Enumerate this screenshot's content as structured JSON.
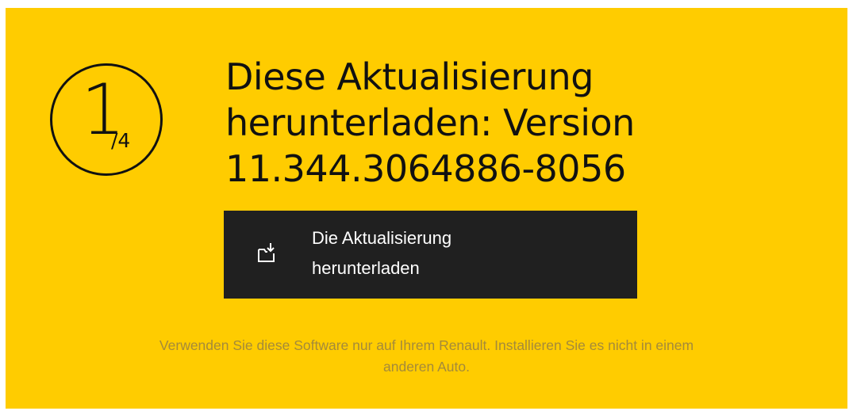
{
  "step": {
    "current": "1",
    "total": "/4"
  },
  "title": {
    "line1": "Diese Aktualisierung",
    "line2": "herunterladen: Version",
    "line3": "11.344.3064886-8056"
  },
  "download_button": {
    "icon": "download-to-folder-icon",
    "label_line1": "Die Aktualisierung",
    "label_line2": "herunterladen"
  },
  "notice": {
    "line1": "Verwenden Sie diese Software nur auf Ihrem Renault. Installieren Sie es nicht in einem",
    "line2": "anderen Auto."
  },
  "colors": {
    "panel_background": "#ffcc00",
    "button_background": "#202020",
    "text_dark": "#111111",
    "notice_text": "#a48a3a"
  }
}
